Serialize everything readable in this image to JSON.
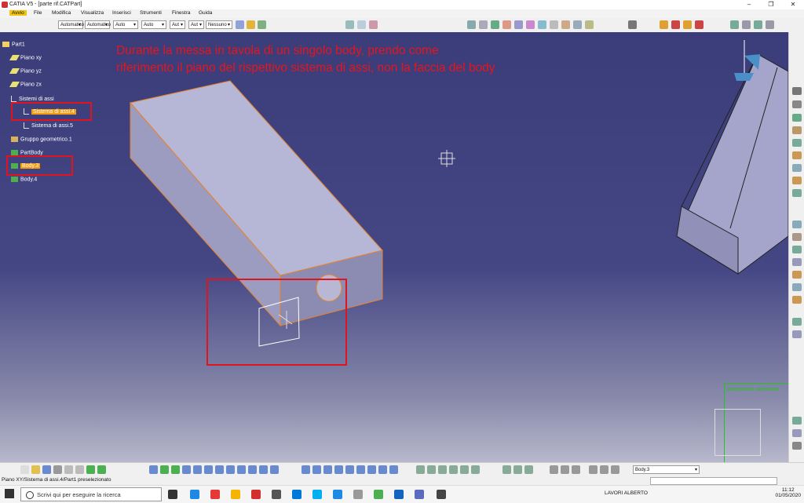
{
  "window": {
    "title": "CATIA V5 - [parte rif.CATPart]",
    "minimize": "–",
    "restore": "❐",
    "close": "✕"
  },
  "menu": [
    "Avvio",
    "File",
    "Modifica",
    "Visualizza",
    "Inserisci",
    "Strumenti",
    "Finestra",
    "Guida"
  ],
  "toolbar_selects": [
    "Automatico",
    "Automatico",
    "Auto",
    "Auto",
    "Aut",
    "Aut",
    "Nessuno"
  ],
  "tree": {
    "root": "Part1",
    "planes": [
      "Piano xy",
      "Piano yz",
      "Piano zx"
    ],
    "axis_group": "Sistemi di assi",
    "axis_systems": [
      "Sistema di assi.4",
      "Sistema di assi.5"
    ],
    "geo_set": "Gruppo geometrico.1",
    "part_body": "PartBody",
    "bodies": [
      "Body.3",
      "Body.4"
    ]
  },
  "annotation": {
    "line1": "Durante la messa in tavola di un singolo body, prendo come",
    "line2": "riferimento il piano del rispettivo sistema di assi, non la faccia del body",
    "color": "#e8141a"
  },
  "preview": {
    "label": "Anteprima orientata"
  },
  "bottom_toolbar": {
    "body_select": "Body.3"
  },
  "status": {
    "text": "Piano XY/Sistema di assi.4/Part1 preselezionato"
  },
  "taskbar": {
    "search_placeholder": "Scrivi qui per eseguire la ricerca",
    "user": "LAVORI ALBERTO",
    "time": "11:12",
    "date": "01/05/2020"
  },
  "colors": {
    "viewport_top": "#3b3d7a",
    "highlight": "#f39c12",
    "red_box": "#e0141e",
    "preview_border": "#1ec71e"
  }
}
